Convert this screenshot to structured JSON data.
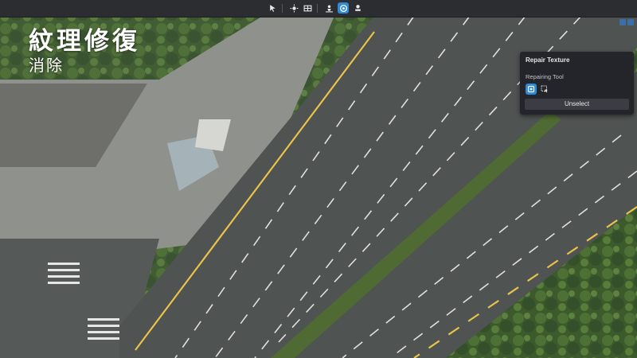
{
  "caption": {
    "title": "紋理修復",
    "subtitle": "消除"
  },
  "toolbar": {
    "tools": [
      {
        "icon": "cursor-arrow-icon",
        "active": false
      },
      {
        "icon": "sun-light-icon",
        "active": false
      },
      {
        "icon": "grid-layer-icon",
        "active": false
      },
      {
        "icon": "person-pin-icon",
        "active": false
      },
      {
        "icon": "texture-repair-icon",
        "active": true
      },
      {
        "icon": "stamp-icon",
        "active": false
      }
    ],
    "accent_color": "#2f8bd8"
  },
  "repair_panel": {
    "title": "Repair Texture",
    "section_label": "Repairing Tool",
    "tools": [
      {
        "icon": "repair-brush-icon",
        "active": true
      },
      {
        "icon": "select-area-icon",
        "active": false
      }
    ],
    "unselect_label": "Unselect"
  }
}
